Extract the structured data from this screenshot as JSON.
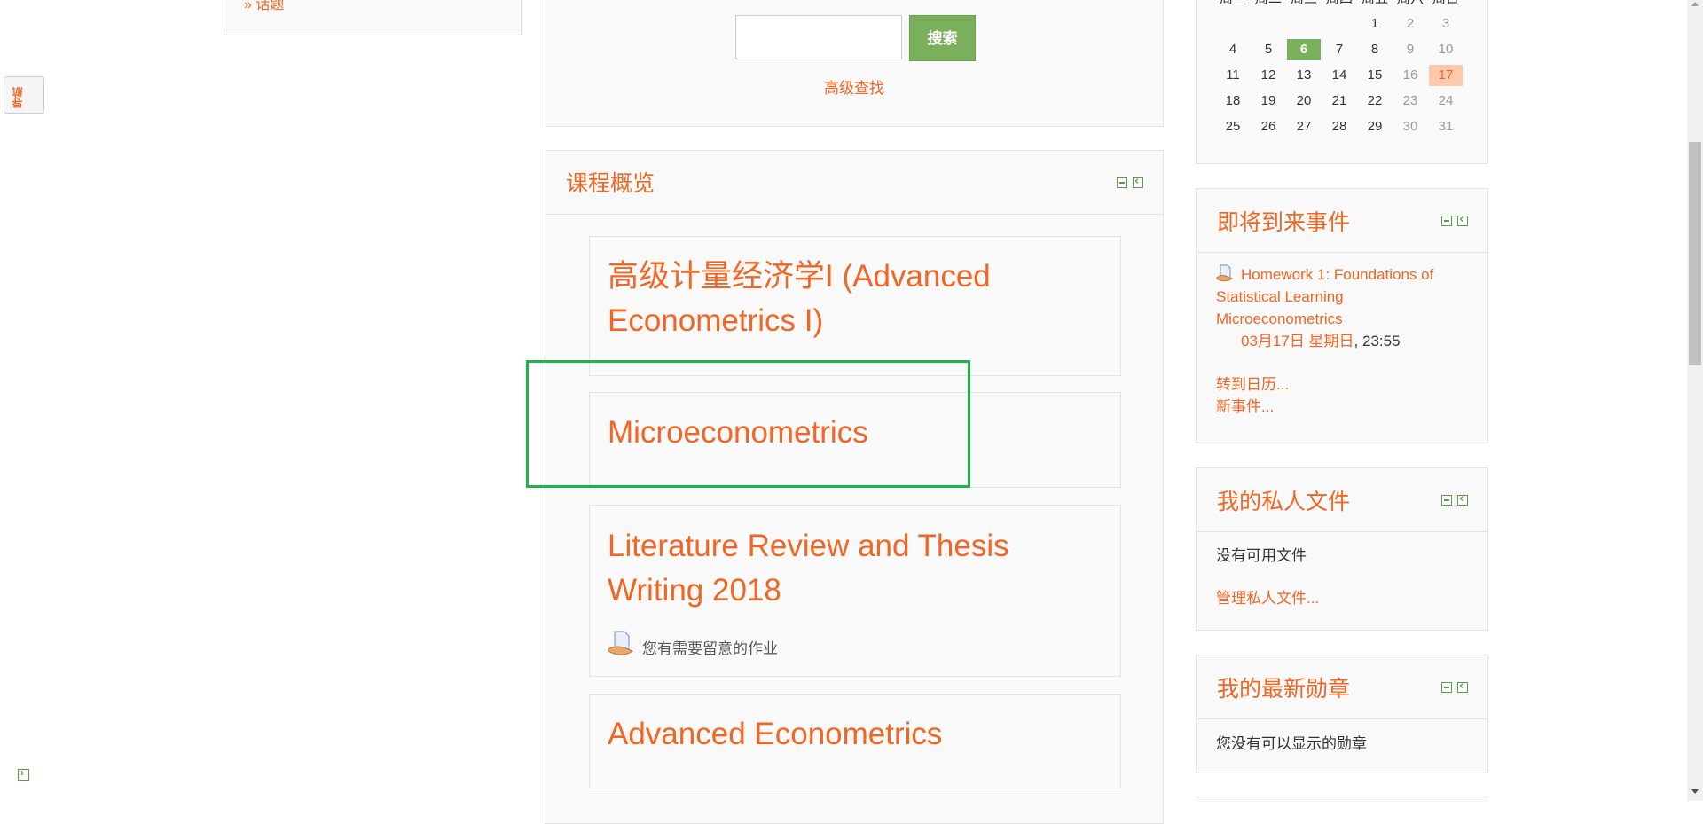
{
  "left_tab": {
    "label": "导航"
  },
  "search": {
    "button": "搜索",
    "advanced": "高级查找",
    "placeholder": ""
  },
  "course_overview": {
    "title": "课程概览",
    "courses": [
      {
        "title": "高级计量经济学I (Advanced Econometrics I)"
      },
      {
        "title": "Microeconometrics"
      },
      {
        "title": "Literature Review and Thesis Writing 2018",
        "notice": "您有需要留意的作业"
      },
      {
        "title": "Advanced Econometrics"
      }
    ]
  },
  "calendar": {
    "weekday_headers": [
      "周一",
      "周二",
      "周三",
      "周四",
      "周五",
      "周六",
      "周日"
    ],
    "rows": [
      [
        "",
        "",
        "",
        "",
        "1",
        "2",
        "3"
      ],
      [
        "4",
        "5",
        "6",
        "7",
        "8",
        "9",
        "10"
      ],
      [
        "11",
        "12",
        "13",
        "14",
        "15",
        "16",
        "17"
      ],
      [
        "18",
        "19",
        "20",
        "21",
        "22",
        "23",
        "24"
      ],
      [
        "25",
        "26",
        "27",
        "28",
        "29",
        "30",
        "31"
      ]
    ],
    "today": "6",
    "event_day": "17"
  },
  "upcoming": {
    "title": "即将到来事件",
    "event_title": "Homework 1: Foundations of Statistical Learning",
    "event_course": "Microeconometrics",
    "event_date": "03月17日 星期日",
    "event_time": ", 23:55",
    "goto_calendar": "转到日历...",
    "new_event": "新事件..."
  },
  "private_files": {
    "title": "我的私人文件",
    "empty": "没有可用文件",
    "manage": "管理私人文件..."
  },
  "badges": {
    "title": "我的最新勋章",
    "empty": "您没有可以显示的勋章"
  },
  "colors": {
    "accent": "#f26522",
    "button_green": "#7aaf5c",
    "highlight_box": "#22b14c"
  }
}
